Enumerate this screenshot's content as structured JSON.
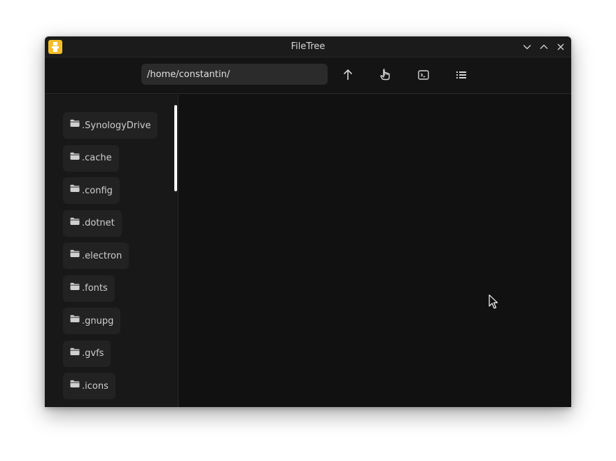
{
  "window": {
    "title": "FileTree",
    "accent": "#f4be2a",
    "background": "#121212"
  },
  "titlebar": {
    "icons": [
      "app-icon",
      "minimize-icon",
      "maximize-icon",
      "close-icon"
    ]
  },
  "toolbar": {
    "path_value": "/home/constantin/",
    "icons": [
      "arrow-up-icon",
      "pointer-hand-icon",
      "terminal-icon",
      "list-icon"
    ]
  },
  "sidebar": {
    "folders": [
      {
        "label": ".SynologyDrive"
      },
      {
        "label": ".cache"
      },
      {
        "label": ".config"
      },
      {
        "label": ".dotnet"
      },
      {
        "label": ".electron"
      },
      {
        "label": ".fonts"
      },
      {
        "label": ".gnupg"
      },
      {
        "label": ".gvfs"
      },
      {
        "label": ".icons"
      }
    ]
  }
}
